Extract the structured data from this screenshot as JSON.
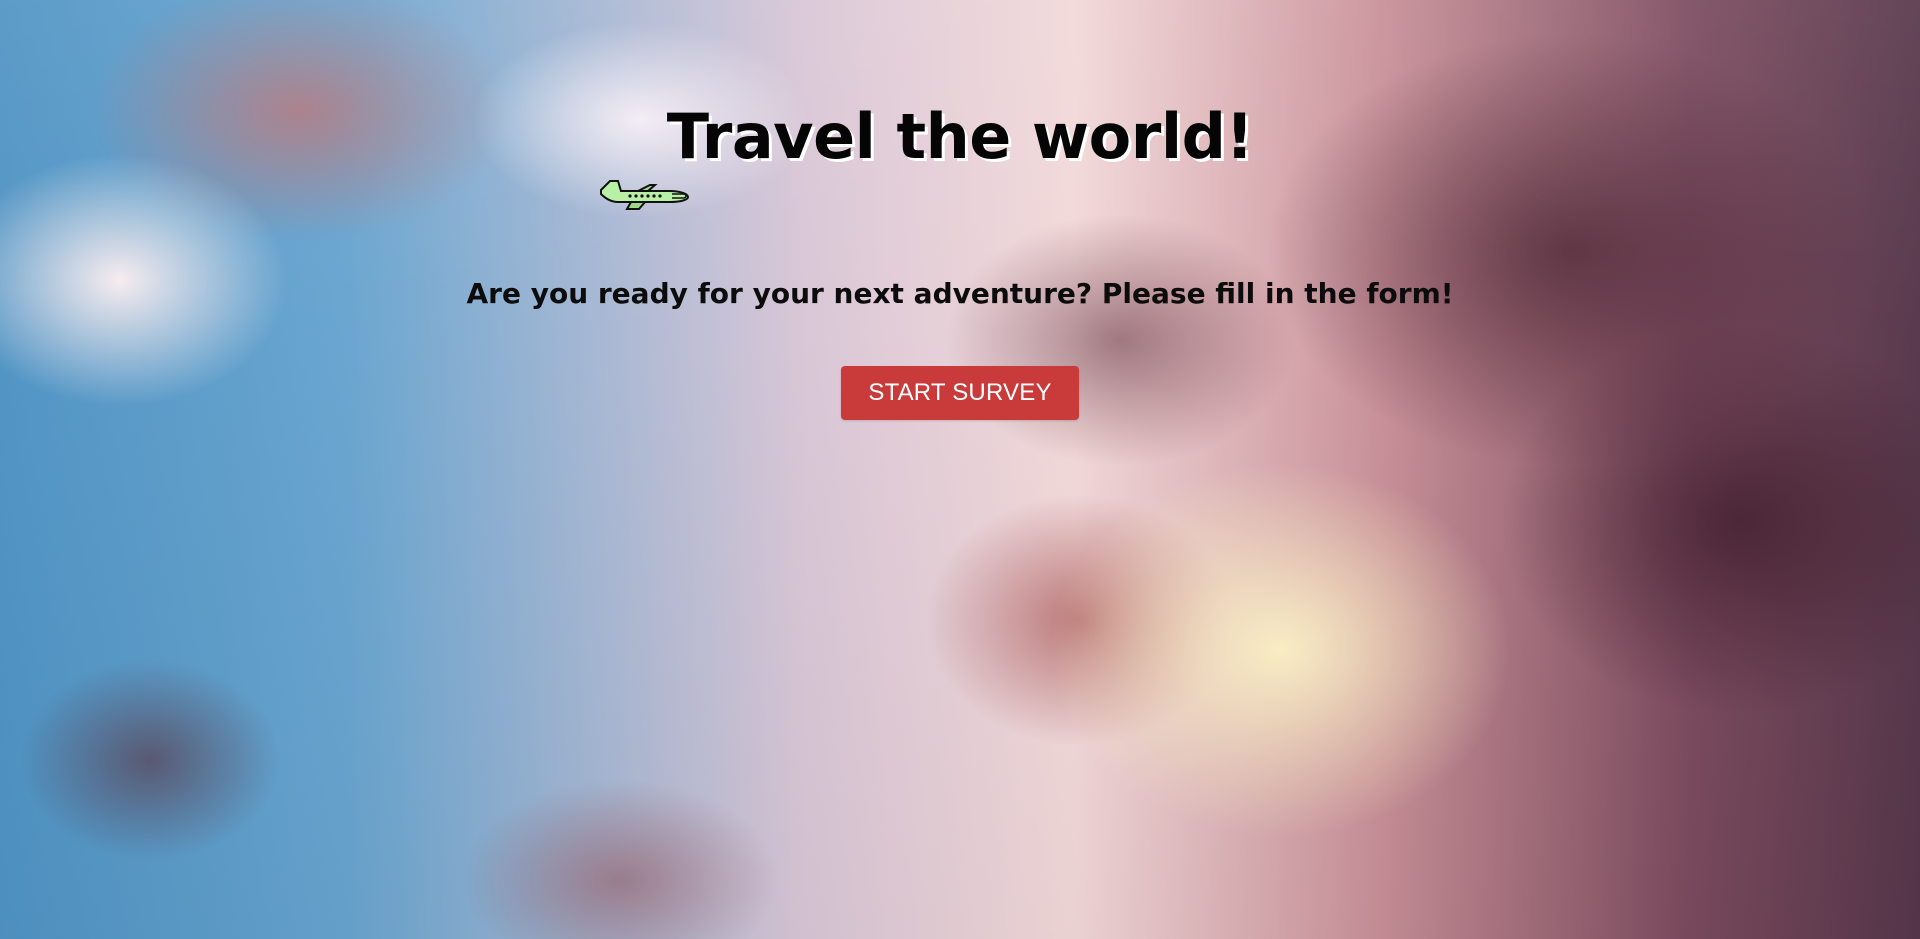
{
  "hero": {
    "title": "Travel the world!",
    "subtitle": "Are you ready for your next adventure? Please fill in the form!",
    "cta_label": "START SURVEY"
  },
  "icons": {
    "plane": "airplane-icon"
  },
  "colors": {
    "title_text": "#050505",
    "subtitle_text": "#0c0c0c",
    "cta_background": "#c93a3a",
    "cta_text": "#ffffff",
    "plane_body": "#b8f0a6"
  }
}
